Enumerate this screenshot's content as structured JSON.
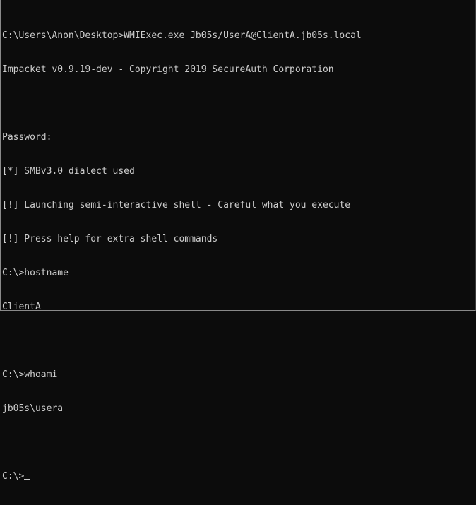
{
  "console": {
    "lines": [
      "C:\\Users\\Anon\\Desktop>WMIExec.exe Jb05s/UserA@ClientA.jb05s.local",
      "Impacket v0.9.19-dev - Copyright 2019 SecureAuth Corporation",
      "",
      "Password:",
      "[*] SMBv3.0 dialect used",
      "[!] Launching semi-interactive shell - Careful what you execute",
      "[!] Press help for extra shell commands",
      "C:\\>hostname",
      "ClientA",
      "",
      "C:\\>whoami",
      "jb05s\\usera",
      ""
    ],
    "prompt": "C:\\>"
  },
  "colors": {
    "background": "#0c0c0c",
    "foreground": "#cccccc"
  }
}
